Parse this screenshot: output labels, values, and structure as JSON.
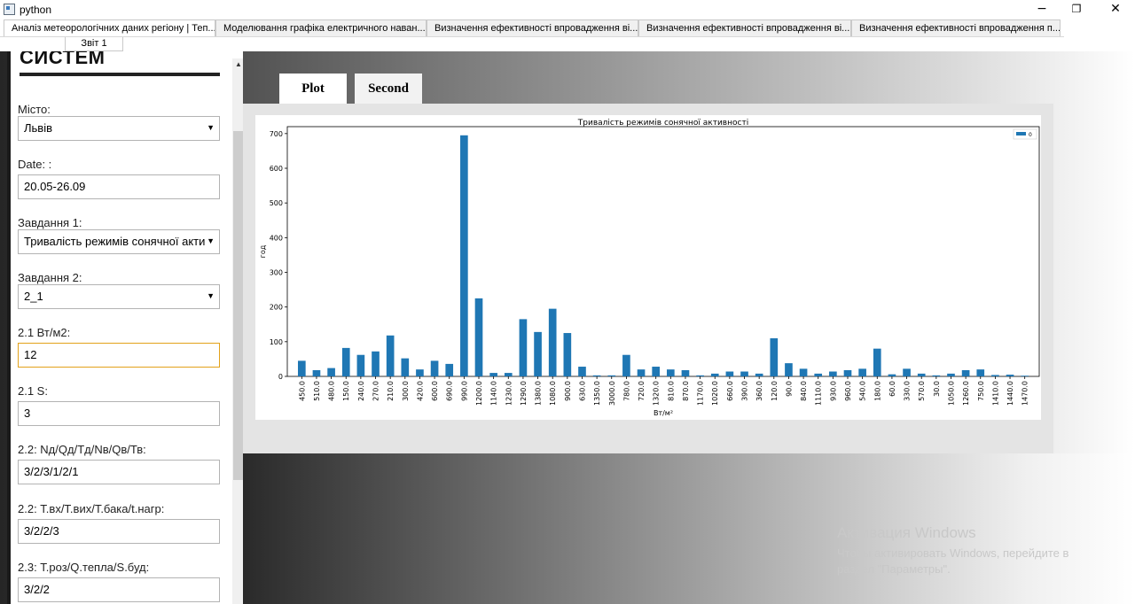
{
  "window": {
    "title": "python",
    "minimize": "−",
    "maximize": "❐",
    "close": "✕"
  },
  "tabs_top": [
    "Аналіз метеорологічних даних регіону | Теп...",
    "Моделювання графіка електричного наван...",
    "Визначення ефективності впровадження ві...",
    "Визначення ефективності впровадження ві...",
    "Визначення ефективності впровадження п..."
  ],
  "tabs_second": [
    "Звіт 1"
  ],
  "panel": {
    "heading": "СИСТЕМ",
    "city_label": "Місто:",
    "city_value": "Львів",
    "date_label": "Date: :",
    "date_value": "20.05-26.09",
    "task1_label": "Завдання 1:",
    "task1_value": "Тривалість режимів сонячної акти",
    "task2_label": "Завдання 2:",
    "task2_value": "2_1",
    "f21w_label": "2.1 Вт/м2:",
    "f21w_value": "12",
    "f21s_label": "2.1 S:",
    "f21s_value": "3",
    "f22n_label": "2.2: Nд/Qд/Тд/Nв/Qв/Тв:",
    "f22n_value": "3/2/3/1/2/1",
    "f22t_label": "2.2: Т.вх/Т.вих/Т.бака/t.нагр:",
    "f22t_value": "3/2/2/3",
    "f23_label": "2.3: Т.роз/Q.тепла/S.буд:",
    "f23_value": "3/2/2"
  },
  "plot_tabs": [
    "Plot",
    "Second"
  ],
  "activation": {
    "title": "Активация Windows",
    "body": "Чтобы активировать Windows, перейдите в раздел \"Параметры\"."
  },
  "colors": {
    "bar": "#1f77b4"
  },
  "chart_data": {
    "type": "bar",
    "title": "Тривалість режимів сонячної активності",
    "xlabel": "Вт/м²",
    "ylabel": "год",
    "legend": "0",
    "legend_position": "top-right",
    "ylim": [
      0,
      720
    ],
    "yticks": [
      0,
      100,
      200,
      300,
      400,
      500,
      600,
      700
    ],
    "categories": [
      "450.0",
      "510.0",
      "480.0",
      "150.0",
      "240.0",
      "270.0",
      "210.0",
      "300.0",
      "420.0",
      "600.0",
      "690.0",
      "990.0",
      "1200.0",
      "1140.0",
      "1230.0",
      "1290.0",
      "1380.0",
      "1080.0",
      "900.0",
      "630.0",
      "1350.0",
      "3000.0",
      "780.0",
      "720.0",
      "1320.0",
      "810.0",
      "870.0",
      "1170.0",
      "1020.0",
      "660.0",
      "390.0",
      "360.0",
      "120.0",
      "90.0",
      "840.0",
      "1110.0",
      "930.0",
      "960.0",
      "540.0",
      "180.0",
      "60.0",
      "330.0",
      "570.0",
      "30.0",
      "1050.0",
      "1260.0",
      "750.0",
      "1410.0",
      "1440.0",
      "1470.0"
    ],
    "values": [
      45,
      18,
      24,
      82,
      62,
      72,
      118,
      52,
      20,
      45,
      36,
      695,
      225,
      10,
      10,
      165,
      128,
      195,
      125,
      28,
      3,
      3,
      62,
      20,
      28,
      20,
      18,
      3,
      8,
      14,
      14,
      8,
      110,
      38,
      22,
      8,
      14,
      18,
      22,
      80,
      6,
      22,
      8,
      3,
      8,
      18,
      20,
      4,
      5,
      2
    ]
  }
}
